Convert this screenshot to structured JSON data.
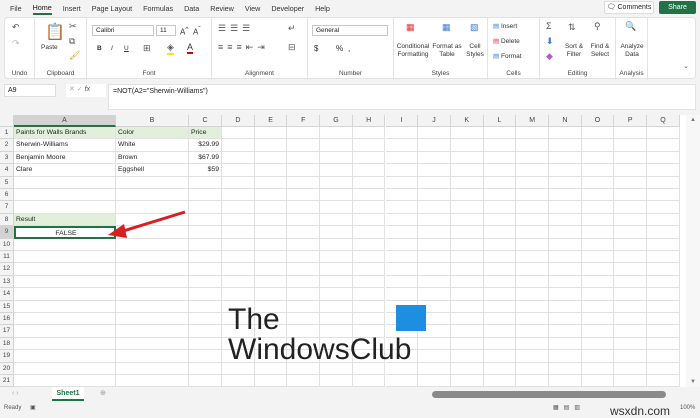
{
  "menu": [
    "File",
    "Home",
    "Insert",
    "Page Layout",
    "Formulas",
    "Data",
    "Review",
    "View",
    "Developer",
    "Help"
  ],
  "active_menu": "Home",
  "comments_label": "Comments",
  "share_label": "Share",
  "ribbon": {
    "undo": "Undo",
    "clipboard": {
      "label": "Clipboard",
      "paste": "Paste"
    },
    "font": {
      "label": "Font",
      "name": "Calibri",
      "size": "11",
      "bold": "B",
      "italic": "I",
      "underline": "U"
    },
    "alignment": "Alignment",
    "number": {
      "label": "Number",
      "format": "General",
      "currency": "$",
      "percent": "%",
      "comma": ","
    },
    "styles": {
      "label": "Styles",
      "conditional": "Conditional Formatting",
      "format_table": "Format as Table",
      "cell_styles": "Cell Styles"
    },
    "cells": {
      "label": "Cells",
      "insert": "Insert",
      "delete": "Delete",
      "format": "Format"
    },
    "editing": {
      "label": "Editing",
      "sort": "Sort & Filter",
      "find": "Find & Select"
    },
    "analysis": {
      "label": "Analysis",
      "analyze": "Analyze Data"
    }
  },
  "name_box": "A9",
  "fx": "fx",
  "formula": "=NOT(A2=\"Sherwin-Williams\")",
  "columns": [
    "A",
    "B",
    "C",
    "D",
    "E",
    "F",
    "G",
    "H",
    "I",
    "J",
    "K",
    "L",
    "M",
    "N",
    "O",
    "P",
    "Q"
  ],
  "rows": [
    [
      "Paints for Walls Brands",
      "Color",
      "Price"
    ],
    [
      "Sherwin-Williams",
      "White",
      "$29.99"
    ],
    [
      "Benjamin Moore",
      "Brown",
      "$67.99"
    ],
    [
      "Clare",
      "Eggshell",
      "$59"
    ],
    [
      "",
      "",
      ""
    ],
    [
      "",
      "",
      ""
    ],
    [
      "",
      "",
      ""
    ],
    [
      "Result",
      "",
      ""
    ],
    [
      "FALSE",
      "",
      ""
    ]
  ],
  "sheet_tab": "Sheet1",
  "status": "Ready",
  "zoom": "100%",
  "watermark": "TheWindowsClub",
  "watermark2": "wsxdn.com"
}
